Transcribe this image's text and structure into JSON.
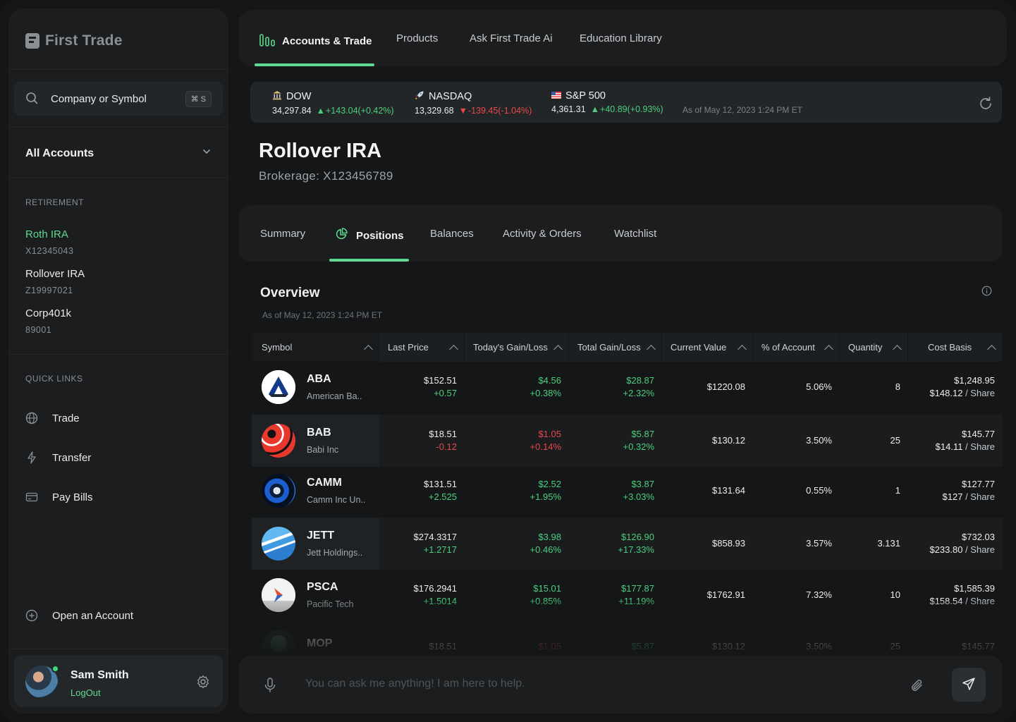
{
  "app": {
    "brand": "First Trade"
  },
  "sidebar": {
    "search": {
      "placeholder": "Company or Symbol",
      "shortcut": "⌘ S"
    },
    "accounts_selector": "All Accounts",
    "retirement_label": "RETIREMENT",
    "accounts": [
      {
        "name": "Roth IRA",
        "number": "X12345043",
        "active": true
      },
      {
        "name": "Rollover IRA",
        "number": "Z19997021",
        "active": false
      },
      {
        "name": "Corp401k",
        "number": "89001",
        "active": false
      }
    ],
    "quick_links_label": "QUICK LINKS",
    "quick_links": [
      {
        "label": "Trade",
        "icon": "globe-icon"
      },
      {
        "label": "Transfer",
        "icon": "bolt-icon"
      },
      {
        "label": "Pay Bills",
        "icon": "card-icon"
      }
    ],
    "open_account": "Open an Account",
    "user": {
      "name": "Sam Smith",
      "logout": "LogOut"
    }
  },
  "topnav": {
    "items": [
      "Accounts & Trade",
      "Products",
      "Ask First Trade Ai",
      "Education Library"
    ],
    "active_index": 0
  },
  "ticker": {
    "indices": [
      {
        "name": "DOW",
        "value": "34,297.84",
        "change": "+143.04(+0.42%)",
        "direction": "up"
      },
      {
        "name": "NASDAQ",
        "value": "13,329.68",
        "change": "-139.45(-1.04%)",
        "direction": "down"
      },
      {
        "name": "S&P 500",
        "value": "4,361.31",
        "change": "+40.89(+0.93%)",
        "direction": "up"
      }
    ],
    "as_of": "As of May 12, 2023 1:24 PM ET"
  },
  "account": {
    "title": "Rollover IRA",
    "subtitle": "Brokerage: X123456789"
  },
  "subtabs": {
    "items": [
      "Summary",
      "Positions",
      "Balances",
      "Activity & Orders",
      "Watchlist"
    ],
    "active_index": 1
  },
  "overview": {
    "title": "Overview",
    "as_of": "As of May 12, 2023 1:24 PM ET"
  },
  "table": {
    "columns": [
      "Symbol",
      "Last Price",
      "Today's Gain/Loss",
      "Total Gain/Loss",
      "Current Value",
      "% of Account",
      "Quantity",
      "Cost Basis"
    ],
    "rows": [
      {
        "symbol": "ABA",
        "company": "American Ba..",
        "last": "$152.51",
        "last_chg": "+0.57",
        "today": "$4.56",
        "today_pct": "+0.38%",
        "today_dir": "up",
        "total": "$28.87",
        "total_pct": "+2.32%",
        "total_dir": "up",
        "value": "$1220.08",
        "pct": "5.06%",
        "qty": "8",
        "cost": "$1,248.95",
        "cost_share": "$148.12",
        "share_label": " / Share"
      },
      {
        "symbol": "BAB",
        "company": "Babi Inc",
        "last": "$18.51",
        "last_chg": "-0.12",
        "today": "$1.05",
        "today_pct": "+0.14%",
        "today_dir": "down",
        "total": "$5.87",
        "total_pct": "+0.32%",
        "total_dir": "up",
        "value": "$130.12",
        "pct": "3.50%",
        "qty": "25",
        "cost": "$145.77",
        "cost_share": "$14.11",
        "share_label": " / Share"
      },
      {
        "symbol": "CAMM",
        "company": "Camm Inc Un..",
        "last": "$131.51",
        "last_chg": "+2.525",
        "today": "$2.52",
        "today_pct": "+1.95%",
        "today_dir": "up",
        "total": "$3.87",
        "total_pct": "+3.03%",
        "total_dir": "up",
        "value": "$131.64",
        "pct": "0.55%",
        "qty": "1",
        "cost": "$127.77",
        "cost_share": "$127",
        "share_label": " / Share"
      },
      {
        "symbol": "JETT",
        "company": "Jett Holdings..",
        "last": "$274.3317",
        "last_chg": "+1.2717",
        "today": "$3.98",
        "today_pct": "+0.46%",
        "today_dir": "up",
        "total": "$126.90",
        "total_pct": "+17.33%",
        "total_dir": "up",
        "value": "$858.93",
        "pct": "3.57%",
        "qty": "3.131",
        "cost": "$732.03",
        "cost_share": "$233.80",
        "share_label": " / Share"
      },
      {
        "symbol": "PSCA",
        "company": "Pacific Tech",
        "last": "$176.2941",
        "last_chg": "+1.5014",
        "today": "$15.01",
        "today_pct": "+0.85%",
        "today_dir": "up",
        "total": "$177.87",
        "total_pct": "+11.19%",
        "total_dir": "up",
        "value": "$1762.91",
        "pct": "7.32%",
        "qty": "10",
        "cost": "$1,585.39",
        "cost_share": "$158.54",
        "share_label": " / Share"
      },
      {
        "symbol": "MOP",
        "company": "",
        "last": "$18.51",
        "last_chg": "",
        "today": "$1.05",
        "today_pct": "",
        "today_dir": "down",
        "total": "$5.87",
        "total_pct": "",
        "total_dir": "up",
        "value": "$130.12",
        "pct": "3.50%",
        "qty": "25",
        "cost": "$145.77",
        "cost_share": "",
        "share_label": ""
      }
    ]
  },
  "chat": {
    "placeholder": "You can ask me anything! I am here to help."
  },
  "colors": {
    "accent": "#5fd98f",
    "gain": "#4ccf7d",
    "loss": "#e5484d",
    "background": "#141617",
    "panel": "#1b1d1f"
  }
}
